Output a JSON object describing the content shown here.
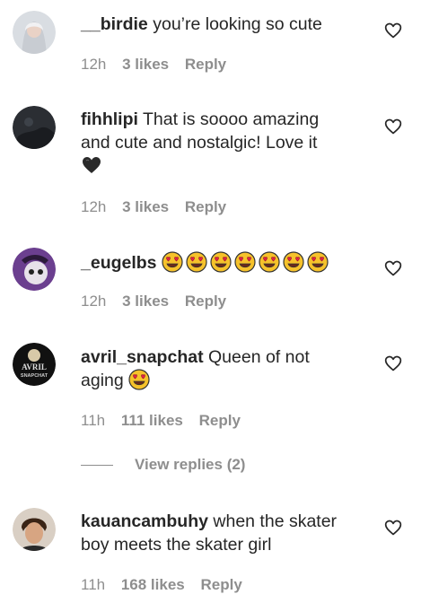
{
  "comments": [
    {
      "username": "__birdie",
      "text": "you’re looking so cute",
      "time": "12h",
      "likes": "3 likes",
      "reply": "Reply",
      "avatar_color": "#bfc6cf",
      "emojis": []
    },
    {
      "username": "fihhlipi",
      "text": "That is soooo amazing and cute and nostalgic! Love it",
      "time": "12h",
      "likes": "3 likes",
      "reply": "Reply",
      "avatar_color": "#2b2e33",
      "emojis": [
        "black-heart-icon"
      ]
    },
    {
      "username": "_eugelbs",
      "text": "",
      "time": "12h",
      "likes": "3 likes",
      "reply": "Reply",
      "avatar_color": "#7b3fa0",
      "emojis": [
        "heart-eyes-icon",
        "heart-eyes-icon",
        "heart-eyes-icon",
        "heart-eyes-icon",
        "heart-eyes-icon",
        "heart-eyes-icon",
        "heart-eyes-icon"
      ]
    },
    {
      "username": "avril_snapchat",
      "text": "Queen of not aging",
      "time": "11h",
      "likes": "111 likes",
      "reply": "Reply",
      "avatar_color": "#111111",
      "avatar_text": "AVRIL SNAPCHAT",
      "emojis": [
        "heart-eyes-icon"
      ]
    },
    {
      "username": "kauancambuhy",
      "text": "when the skater boy meets the skater girl",
      "time": "11h",
      "likes": "168 likes",
      "reply": "Reply",
      "avatar_color": "#6b4a34",
      "emojis": []
    }
  ],
  "view_replies": "View replies (2)",
  "colors": {
    "text": "#262626",
    "meta": "#8e8e8e",
    "background": "#ffffff"
  }
}
